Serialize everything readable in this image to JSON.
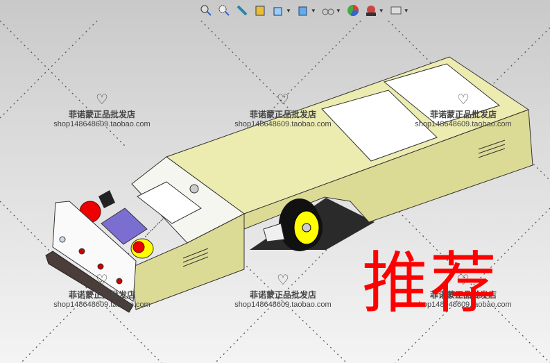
{
  "toolbar": {
    "items": [
      {
        "name": "zoom-to-fit-icon"
      },
      {
        "name": "zoom-to-area-icon"
      },
      {
        "name": "previous-view-icon"
      },
      {
        "name": "section-view-icon"
      },
      {
        "name": "view-orientation-icon",
        "dropdown": true
      },
      {
        "name": "display-style-icon",
        "dropdown": true
      },
      {
        "name": "hide-show-items-icon",
        "dropdown": true
      },
      {
        "name": "edit-appearance-icon"
      },
      {
        "name": "apply-scene-icon",
        "dropdown": true
      },
      {
        "name": "view-settings-icon",
        "dropdown": true
      }
    ]
  },
  "watermark": {
    "shop_name": "菲诺蒙正品批发店",
    "url": "shop148648609.taobao.com"
  },
  "overlay_text": "推荐",
  "colors": {
    "body": "#e6e6a6",
    "body_side": "#d8d890",
    "accent_red": "#ff0000",
    "panel_blue": "#7a6fd0"
  }
}
